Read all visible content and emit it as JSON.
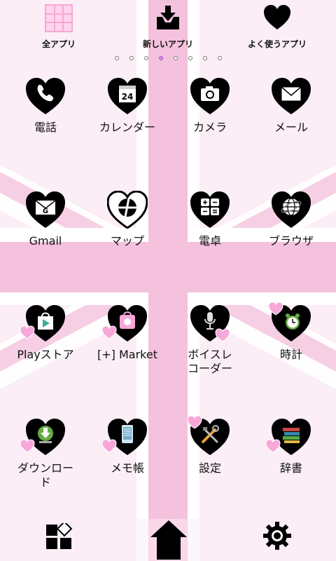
{
  "top": {
    "all_apps": "全アプリ",
    "new_apps": "新しいアプリ",
    "favorite_apps": "よく使うアプリ"
  },
  "page_indicator": {
    "count": 8,
    "active_index": 3
  },
  "apps": [
    {
      "label": "電話",
      "icon": "phone-icon"
    },
    {
      "label": "カレンダー",
      "icon": "calendar-icon",
      "date": "24"
    },
    {
      "label": "カメラ",
      "icon": "camera-icon"
    },
    {
      "label": "メール",
      "icon": "mail-icon"
    },
    {
      "label": "Gmail",
      "icon": "gmail-icon"
    },
    {
      "label": "マップ",
      "icon": "map-icon"
    },
    {
      "label": "電卓",
      "icon": "calculator-icon"
    },
    {
      "label": "ブラウザ",
      "icon": "globe-icon"
    },
    {
      "label": "Playストア",
      "icon": "play-store-icon"
    },
    {
      "label": "[+] Market",
      "icon": "market-icon"
    },
    {
      "label": "ボイスレコーダー",
      "label_line2": "コーダー",
      "label_line1": "ボイスレ",
      "icon": "microphone-icon"
    },
    {
      "label": "時計",
      "icon": "alarm-clock-icon"
    },
    {
      "label": "ダウンロード",
      "label_line1": "ダウンロー",
      "label_line2": "ド",
      "icon": "download-icon"
    },
    {
      "label": "メモ帳",
      "icon": "memo-icon"
    },
    {
      "label": "設定",
      "icon": "settings-tools-icon"
    },
    {
      "label": "辞書",
      "icon": "dictionary-icon"
    }
  ],
  "colors": {
    "background": "#fbeef6",
    "stripe_pink": "#f5c6df",
    "heart": "#000000",
    "accent_heart": "#f7a8d8"
  }
}
